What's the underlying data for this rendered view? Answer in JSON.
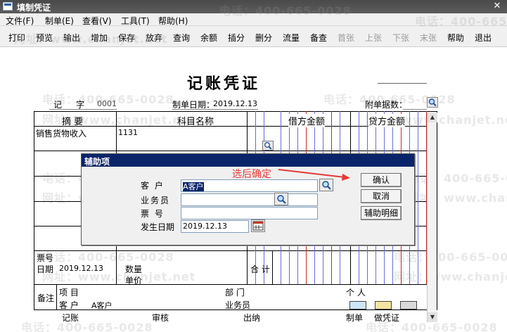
{
  "window": {
    "title": "填制凭证"
  },
  "menu": [
    "文件(F)",
    "制单(E)",
    "查看(V)",
    "工具(T)",
    "帮助(H)"
  ],
  "toolbar": {
    "buttons": [
      {
        "label": "打印",
        "enabled": true
      },
      {
        "label": "预览",
        "enabled": true
      },
      {
        "label": "输出",
        "enabled": true
      },
      {
        "label": "增加",
        "enabled": true
      },
      {
        "label": "保存",
        "enabled": true
      },
      {
        "label": "放弃",
        "enabled": true
      },
      {
        "label": "查询",
        "enabled": true
      },
      {
        "label": "余额",
        "enabled": true
      },
      {
        "label": "插分",
        "enabled": true
      },
      {
        "label": "删分",
        "enabled": true
      },
      {
        "label": "流量",
        "enabled": true
      },
      {
        "label": "备查",
        "enabled": true
      },
      {
        "label": "首张",
        "enabled": false
      },
      {
        "label": "上张",
        "enabled": false
      },
      {
        "label": "下张",
        "enabled": false
      },
      {
        "label": "末张",
        "enabled": false
      },
      {
        "label": "帮助",
        "enabled": true
      },
      {
        "label": "退出",
        "enabled": true
      }
    ]
  },
  "watermark": {
    "phone": "电话：400-665-0028",
    "site": "网址：www.chanjet.net"
  },
  "voucher": {
    "title": "记账凭证",
    "type_label": "记",
    "number_label": "字",
    "number": "0001",
    "date_label": "制单日期：",
    "date": "2019.12.13",
    "attachment_label": "附单据数：",
    "columns": {
      "summary": "摘 要",
      "account": "科目名称",
      "debit": "借方金额",
      "credit": "贷方金额"
    },
    "row1": {
      "summary": "销售货物收入",
      "account": "1131"
    },
    "footer": {
      "bill_no": "票号",
      "date_label": "日期",
      "date_value": "2019.12.13",
      "quantity": "数量",
      "unit_price": "单价",
      "total": "合 计",
      "remark": "备注",
      "project": "项 目",
      "department": "部 门",
      "person": "个 人",
      "customer_label": "客 户",
      "customer_value": "A客户",
      "salesman": "业务员"
    },
    "signatures": [
      "记账",
      "审核",
      "出纳",
      "制单",
      "做凭证"
    ]
  },
  "dialog": {
    "title": "辅助项",
    "annotation": "选后确定",
    "fields": {
      "customer_label": "客 户",
      "customer_value": "A客户",
      "salesman_label": "业务员",
      "ticket_label": "票 号",
      "date_label": "发生日期",
      "date_value": "2019.12.13"
    },
    "buttons": {
      "ok": "确认",
      "cancel": "取消",
      "detail": "辅助明细"
    }
  },
  "colors": {
    "dialog_title": "#0a246a",
    "annotation": "#e53935",
    "grid_blue": "#6b6bd6",
    "grid_red": "#c62828"
  }
}
